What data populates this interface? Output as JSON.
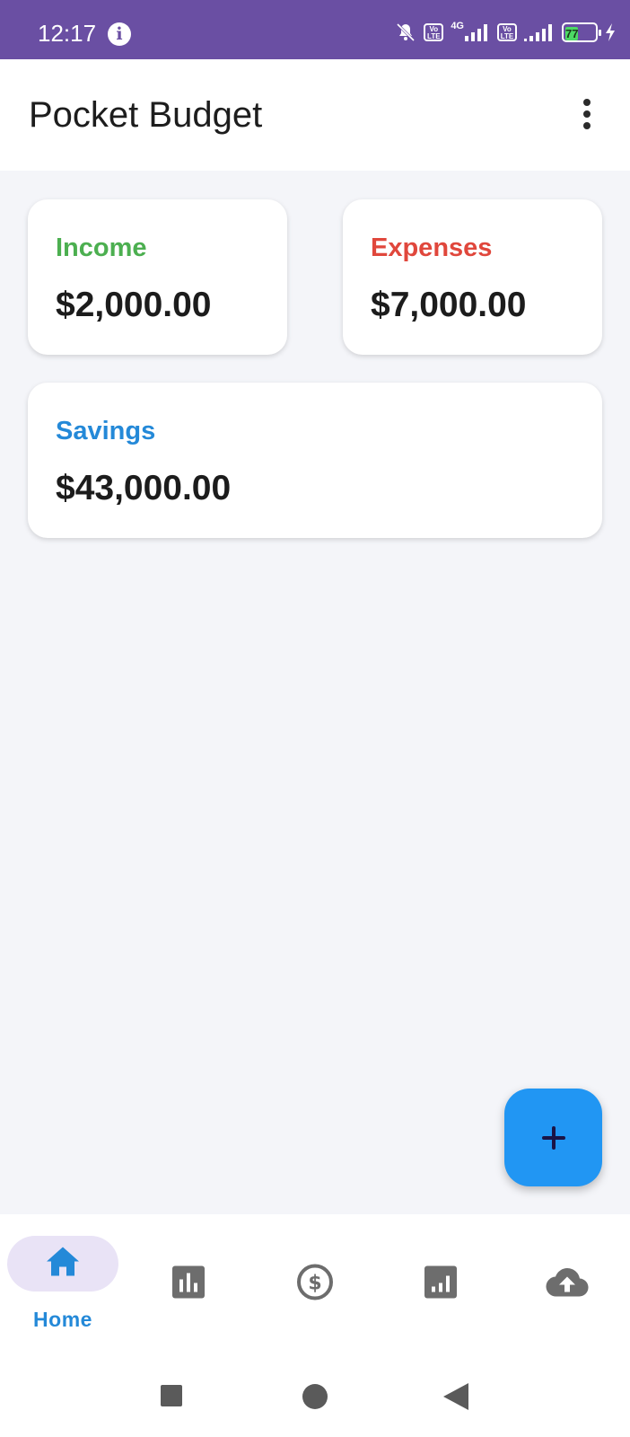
{
  "status_bar": {
    "time": "12:17",
    "network_label": "4G",
    "volte_label": "Vo LTE",
    "battery_level": "77",
    "background_color": "#6a4fa3",
    "icons": [
      "info-icon",
      "silent-bell-icon",
      "volte-icon",
      "signal-icon",
      "battery-icon",
      "charging-icon"
    ]
  },
  "app_bar": {
    "title": "Pocket Budget",
    "menu_icon": "more-vert-icon"
  },
  "cards": {
    "income": {
      "label": "Income",
      "value": "$2,000.00",
      "color": "#4caf50"
    },
    "expenses": {
      "label": "Expenses",
      "value": "$7,000.00",
      "color": "#e0473c"
    },
    "savings": {
      "label": "Savings",
      "value": "$43,000.00",
      "color": "#2489d8"
    }
  },
  "fab": {
    "icon": "plus-icon",
    "color": "#2196f3"
  },
  "bottom_nav": {
    "active_color": "#2489d8",
    "inactive_color": "#6d6d6d",
    "items": [
      {
        "label": "Home",
        "icon": "home-icon",
        "active": true
      },
      {
        "label": "",
        "icon": "bar-chart-icon",
        "active": false
      },
      {
        "label": "",
        "icon": "dollar-circle-icon",
        "active": false
      },
      {
        "label": "",
        "icon": "report-chart-icon",
        "active": false
      },
      {
        "label": "",
        "icon": "cloud-upload-icon",
        "active": false
      }
    ]
  },
  "system_nav": {
    "icons": [
      "recents-square-icon",
      "home-circle-icon",
      "back-triangle-icon"
    ]
  }
}
